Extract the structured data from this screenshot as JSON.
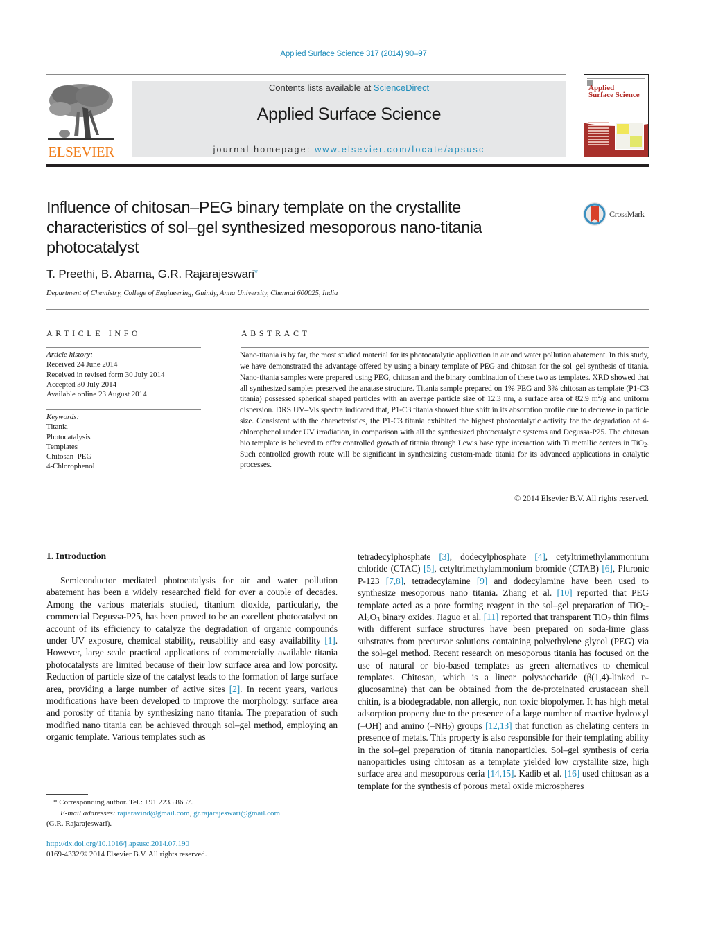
{
  "citation": "Applied Surface Science 317 (2014) 90–97",
  "header": {
    "publisher_wordmark": "ELSEVIER",
    "contents_prefix": "Contents lists available at ",
    "contents_link": "ScienceDirect",
    "journal_title": "Applied Surface Science",
    "homepage_prefix": "journal homepage: ",
    "homepage_link": "www.elsevier.com/locate/apsusc",
    "cover_title_line1": "Applied",
    "cover_title_line2": "Surface Science"
  },
  "crossmark_label": "CrossMark",
  "colors": {
    "link": "#1f8dbb",
    "elsevier_orange": "#f07d1a",
    "banner_grey": "#e6e7e8",
    "cover_red": "#a8302b"
  },
  "article": {
    "title": "Influence of chitosan–PEG binary template on the crystallite characteristics of sol–gel synthesized mesoporous nano-titania photocatalyst",
    "authors": "T. Preethi, B. Abarna, G.R. Rajarajeswari",
    "corresponding_mark": "*",
    "affiliation": "Department of Chemistry, College of Engineering, Guindy, Anna University, Chennai 600025, India"
  },
  "article_info": {
    "heading": "ARTICLE INFO",
    "history_label": "Article history:",
    "history": [
      "Received 24 June 2014",
      "Received in revised form 30 July 2014",
      "Accepted 30 July 2014",
      "Available online 23 August 2014"
    ],
    "keywords_label": "Keywords:",
    "keywords": [
      "Titania",
      "Photocatalysis",
      "Templates",
      "Chitosan–PEG",
      "4-Chlorophenol"
    ]
  },
  "abstract": {
    "heading": "ABSTRACT",
    "part1": "Nano-titania is by far, the most studied material for its photocatalytic application in air and water pollution abatement. In this study, we have demonstrated the advantage offered by using a binary template of PEG and chitosan for the sol–gel synthesis of titania. Nano-titania samples were prepared using PEG, chitosan and the binary combination of these two as templates. XRD showed that all synthesized samples preserved the anatase structure. Titania sample prepared on 1% PEG and 3% chitosan as template (P1-C3 titania) possessed spherical shaped particles with an average particle size of 12.3 nm, a surface area of 82.9 m",
    "sup1": "2",
    "part2": "/g and uniform dispersion. DRS UV–Vis spectra indicated that, P1-C3 titania showed blue shift in its absorption profile due to decrease in particle size. Consistent with the characteristics, the P1-C3 titania exhibited the highest photocatalytic activity for the degradation of 4-chlorophenol under UV irradiation, in comparison with all the synthesized photocatalytic systems and Degussa-P25. The chitosan bio template is believed to offer controlled growth of titania through Lewis base type interaction with Ti metallic centers in TiO",
    "sub1": "2",
    "part3": ". Such controlled growth route will be significant in synthesizing custom-made titania for its advanced applications in catalytic processes.",
    "copyright": "© 2014 Elsevier B.V. All rights reserved."
  },
  "introduction": {
    "heading": "1.  Introduction",
    "left": [
      {
        "t": "Semiconductor mediated photocatalysis for air and water pollution abatement has been a widely researched field for over a couple of decades. Among the various materials studied, titanium dioxide, particularly, the commercial Degussa-P25, has been proved to be an excellent photocatalyst on account of its efficiency to catalyze the degradation of organic compounds under UV exposure, chemical stability, reusability and easy availability "
      },
      {
        "c": "[1]"
      },
      {
        "t": ". However, large scale practical applications of commercially available titania photocatalysts are limited because of their low surface area and low porosity. Reduction of particle size of the catalyst leads to the formation of large surface area, providing a large number of active sites "
      },
      {
        "c": "[2]"
      },
      {
        "t": ". In recent years, various modifications have been developed to improve the morphology, surface area and porosity of titania by synthesizing nano titania. The preparation of such modified nano titania can be achieved through sol–gel method, employing an organic template. Various templates such as"
      }
    ],
    "right": [
      {
        "t": "tetradecylphosphate "
      },
      {
        "c": "[3]"
      },
      {
        "t": ", dodecylphosphate "
      },
      {
        "c": "[4]"
      },
      {
        "t": ", cetyltrimethylammonium chloride (CTAC) "
      },
      {
        "c": "[5]"
      },
      {
        "t": ", cetyltrimethylammonium bromide (CTAB) "
      },
      {
        "c": "[6]"
      },
      {
        "t": ", Pluronic P-123 "
      },
      {
        "c": "[7,8]"
      },
      {
        "t": ", tetradecylamine "
      },
      {
        "c": "[9]"
      },
      {
        "t": " and dodecylamine have been used to synthesize mesoporous nano titania. Zhang et al. "
      },
      {
        "c": "[10]"
      },
      {
        "t": " reported that PEG template acted as a pore forming reagent in the sol–gel preparation of TiO"
      },
      {
        "s": "2"
      },
      {
        "t": "-Al"
      },
      {
        "s": "2"
      },
      {
        "t": "O"
      },
      {
        "s": "3"
      },
      {
        "t": " binary oxides. Jiaguo et al. "
      },
      {
        "c": "[11]"
      },
      {
        "t": " reported that transparent TiO"
      },
      {
        "s": "2"
      },
      {
        "t": " thin films with different surface structures have been prepared on soda-lime glass substrates from precursor solutions containing polyethylene glycol (PEG) via the sol–gel method. Recent research on mesoporous titania has focused on the use of natural or bio-based templates as green alternatives to chemical templates. Chitosan, which is a linear polysaccharide (β(1,4)-linked "
      },
      {
        "sc": "d"
      },
      {
        "t": "-glucosamine) that can be obtained from the de-proteinated crustacean shell chitin, is a biodegradable, non allergic, non toxic biopolymer. It has high metal adsorption property due to the presence of a large number of reactive hydroxyl (–OH) and amino (–NH"
      },
      {
        "s": "2"
      },
      {
        "t": ") groups "
      },
      {
        "c": "[12,13]"
      },
      {
        "t": " that function as chelating centers in presence of metals. This property is also responsible for their templating ability in the sol–gel preparation of titania nanoparticles. Sol–gel synthesis of ceria nanoparticles using chitosan as a template yielded low crystallite size, high surface area and mesoporous ceria "
      },
      {
        "c": "[14,15]"
      },
      {
        "t": ". Kadib et al. "
      },
      {
        "c": "[16]"
      },
      {
        "t": " used chitosan as a template for the synthesis of porous metal oxide microspheres"
      }
    ]
  },
  "footnotes": {
    "corresponding": "*  Corresponding author. Tel.: +91 2235 8657.",
    "email_label": "E-mail addresses: ",
    "email1": "rajiaravind@gmail.com",
    "email_sep": ", ",
    "email2": "gr.rajarajeswari@gmail.com",
    "email_owner": "(G.R. Rajarajeswari).",
    "doi": "http://dx.doi.org/10.1016/j.apsusc.2014.07.190",
    "issn_line": "0169-4332/© 2014 Elsevier B.V. All rights reserved."
  }
}
